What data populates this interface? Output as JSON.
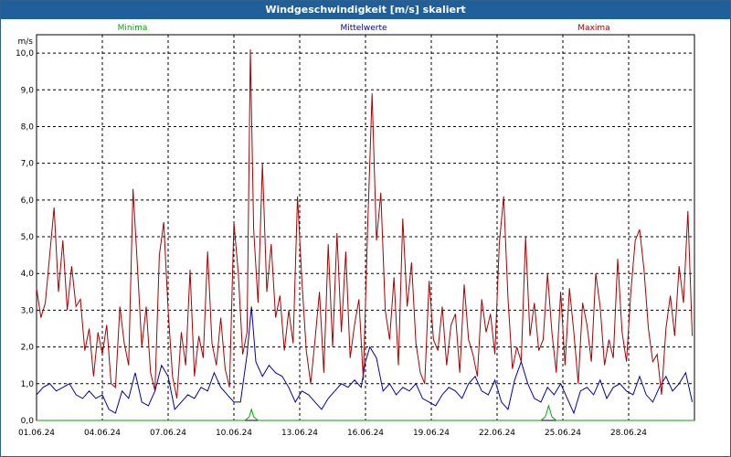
{
  "window": {
    "title": "Windgeschwindigkeit [m/s] skaliert"
  },
  "colors": {
    "minima": "#00aa00",
    "mittelwerte": "#0000aa",
    "maxima": "#aa0000",
    "grid": "#000000",
    "titlebar": "#1f5f9a"
  },
  "chart_data": {
    "type": "line",
    "title": "Windgeschwindigkeit [m/s] skaliert",
    "ylabel": "m/s",
    "xlabel": "",
    "ylim": [
      0,
      10.5
    ],
    "xlim": [
      "01.06.24 00:00",
      "30.06.24 24:00"
    ],
    "grid": true,
    "legend_position": "top",
    "y_ticks": [
      "0,0",
      "1,0",
      "2,0",
      "3,0",
      "4,0",
      "5,0",
      "6,0",
      "7,0",
      "8,0",
      "9,0",
      "10,0"
    ],
    "y_tick_values": [
      0,
      1,
      2,
      3,
      4,
      5,
      6,
      7,
      8,
      9,
      10
    ],
    "x_ticks": [
      "01.06.24",
      "04.06.24",
      "07.06.24",
      "10.06.24",
      "13.06.24",
      "16.06.24",
      "19.06.24",
      "22.06.24",
      "25.06.24",
      "28.06.24"
    ],
    "x_tick_days": [
      0,
      3,
      6,
      9,
      12,
      15,
      18,
      21,
      24,
      27
    ],
    "series": [
      {
        "name": "Minima",
        "color": "#00aa00",
        "x": [
          0,
          9.5,
          9.7,
          9.8,
          9.9,
          10.1,
          23,
          23.2,
          23.35,
          23.5,
          23.7,
          30
        ],
        "y": [
          0,
          0,
          0.1,
          0.3,
          0.1,
          0,
          0,
          0.1,
          0.4,
          0.1,
          0,
          0
        ]
      },
      {
        "name": "Mittelwerte",
        "color": "#0000aa",
        "x": [
          0,
          0.3,
          0.6,
          0.9,
          1.2,
          1.5,
          1.8,
          2.1,
          2.4,
          2.7,
          3.0,
          3.3,
          3.6,
          3.9,
          4.2,
          4.5,
          4.8,
          5.1,
          5.4,
          5.7,
          6.0,
          6.3,
          6.6,
          6.9,
          7.2,
          7.5,
          7.8,
          8.1,
          8.4,
          8.7,
          9.0,
          9.3,
          9.6,
          9.8,
          10.0,
          10.3,
          10.6,
          10.9,
          11.2,
          11.5,
          11.8,
          12.1,
          12.4,
          12.7,
          13.0,
          13.3,
          13.6,
          13.9,
          14.2,
          14.5,
          14.8,
          15.0,
          15.2,
          15.5,
          15.8,
          16.1,
          16.4,
          16.7,
          17.0,
          17.3,
          17.6,
          17.9,
          18.2,
          18.5,
          18.8,
          19.1,
          19.4,
          19.7,
          20.0,
          20.3,
          20.6,
          20.9,
          21.2,
          21.5,
          21.8,
          22.1,
          22.4,
          22.7,
          23.0,
          23.3,
          23.6,
          23.9,
          24.2,
          24.5,
          24.8,
          25.1,
          25.4,
          25.7,
          26.0,
          26.3,
          26.6,
          26.9,
          27.2,
          27.5,
          27.8,
          28.1,
          28.4,
          28.7,
          29.0,
          29.3,
          29.6,
          29.9
        ],
        "y": [
          0.7,
          0.9,
          1.0,
          0.8,
          0.9,
          1.0,
          0.7,
          0.6,
          0.8,
          0.6,
          0.7,
          0.3,
          0.2,
          0.8,
          0.6,
          1.3,
          0.5,
          0.4,
          0.8,
          1.5,
          1.2,
          0.3,
          0.5,
          0.7,
          0.6,
          0.9,
          0.8,
          1.3,
          0.9,
          0.7,
          0.5,
          0.5,
          1.8,
          3.1,
          1.6,
          1.2,
          1.5,
          1.3,
          1.2,
          0.9,
          0.5,
          0.8,
          0.7,
          0.5,
          0.3,
          0.6,
          0.8,
          1.0,
          0.9,
          1.1,
          0.9,
          1.6,
          2.0,
          1.7,
          0.8,
          1.0,
          0.7,
          0.9,
          0.8,
          1.0,
          0.6,
          0.5,
          0.4,
          0.7,
          0.9,
          0.8,
          0.6,
          1.0,
          1.2,
          0.8,
          0.7,
          1.1,
          0.5,
          0.3,
          1.1,
          1.6,
          1.0,
          0.6,
          0.5,
          0.9,
          0.7,
          1.0,
          0.6,
          0.2,
          0.8,
          0.9,
          0.7,
          1.1,
          0.6,
          0.9,
          1.0,
          0.8,
          0.7,
          1.2,
          0.7,
          0.5,
          0.9,
          1.2,
          0.8,
          1.0,
          1.3,
          0.5
        ]
      },
      {
        "name": "Maxima",
        "color": "#aa0000",
        "x": [
          0,
          0.2,
          0.4,
          0.6,
          0.8,
          1.0,
          1.2,
          1.4,
          1.6,
          1.8,
          2.0,
          2.2,
          2.4,
          2.6,
          2.8,
          3.0,
          3.2,
          3.4,
          3.6,
          3.8,
          4.0,
          4.2,
          4.4,
          4.6,
          4.8,
          5.0,
          5.2,
          5.4,
          5.6,
          5.8,
          6.0,
          6.2,
          6.4,
          6.6,
          6.8,
          7.0,
          7.2,
          7.4,
          7.6,
          7.8,
          8.0,
          8.2,
          8.4,
          8.6,
          8.8,
          9.0,
          9.2,
          9.4,
          9.6,
          9.75,
          9.9,
          10.1,
          10.3,
          10.5,
          10.7,
          10.9,
          11.1,
          11.3,
          11.5,
          11.7,
          11.9,
          12.1,
          12.3,
          12.5,
          12.7,
          12.9,
          13.1,
          13.3,
          13.5,
          13.7,
          13.9,
          14.1,
          14.3,
          14.5,
          14.7,
          14.9,
          15.1,
          15.3,
          15.5,
          15.7,
          15.9,
          16.1,
          16.3,
          16.5,
          16.7,
          16.9,
          17.1,
          17.3,
          17.5,
          17.7,
          17.9,
          18.1,
          18.3,
          18.5,
          18.7,
          18.9,
          19.1,
          19.3,
          19.5,
          19.7,
          19.9,
          20.1,
          20.3,
          20.5,
          20.7,
          20.9,
          21.1,
          21.3,
          21.5,
          21.7,
          21.9,
          22.1,
          22.3,
          22.5,
          22.7,
          22.9,
          23.1,
          23.3,
          23.5,
          23.7,
          23.9,
          24.1,
          24.3,
          24.5,
          24.7,
          24.9,
          25.1,
          25.3,
          25.5,
          25.7,
          25.9,
          26.1,
          26.3,
          26.5,
          26.7,
          26.9,
          27.1,
          27.3,
          27.5,
          27.7,
          27.9,
          28.1,
          28.3,
          28.5,
          28.7,
          28.9,
          29.1,
          29.3,
          29.5,
          29.7,
          29.9
        ],
        "y": [
          3.6,
          2.8,
          3.2,
          4.5,
          5.8,
          3.5,
          4.9,
          3.0,
          4.2,
          3.1,
          3.3,
          1.9,
          2.5,
          1.2,
          2.4,
          1.8,
          2.6,
          1.0,
          0.9,
          3.1,
          2.1,
          1.5,
          6.3,
          4.2,
          2.0,
          3.1,
          1.3,
          0.8,
          4.5,
          5.4,
          3.0,
          1.2,
          0.6,
          2.4,
          1.5,
          4.1,
          1.2,
          2.3,
          1.7,
          4.6,
          2.1,
          1.5,
          2.8,
          1.4,
          0.9,
          5.4,
          4.0,
          1.8,
          2.4,
          10.1,
          5.2,
          3.2,
          7.0,
          3.5,
          4.8,
          2.8,
          3.4,
          1.9,
          3.0,
          2.1,
          6.1,
          3.8,
          1.9,
          1.0,
          2.2,
          3.5,
          1.3,
          4.8,
          2.0,
          5.1,
          2.4,
          4.6,
          1.7,
          2.6,
          3.3,
          1.1,
          5.3,
          8.9,
          4.9,
          6.2,
          3.0,
          2.2,
          3.9,
          1.5,
          5.5,
          3.1,
          4.3,
          2.1,
          1.3,
          1.0,
          3.8,
          2.2,
          1.9,
          3.1,
          1.5,
          2.6,
          2.9,
          1.3,
          3.7,
          2.2,
          1.8,
          1.2,
          3.3,
          2.4,
          2.9,
          1.8,
          4.8,
          6.1,
          3.3,
          1.4,
          2.0,
          1.6,
          5.0,
          2.3,
          3.2,
          1.9,
          2.2,
          4.0,
          2.4,
          1.3,
          3.5,
          1.5,
          3.6,
          2.4,
          1.0,
          3.2,
          2.6,
          1.6,
          4.0,
          3.1,
          1.5,
          2.2,
          1.7,
          4.4,
          2.4,
          1.6,
          3.5,
          4.9,
          5.2,
          4.1,
          2.5,
          1.6,
          1.8,
          0.7,
          2.5,
          3.4,
          2.3,
          4.2,
          3.2,
          5.7,
          2.3
        ]
      }
    ]
  }
}
